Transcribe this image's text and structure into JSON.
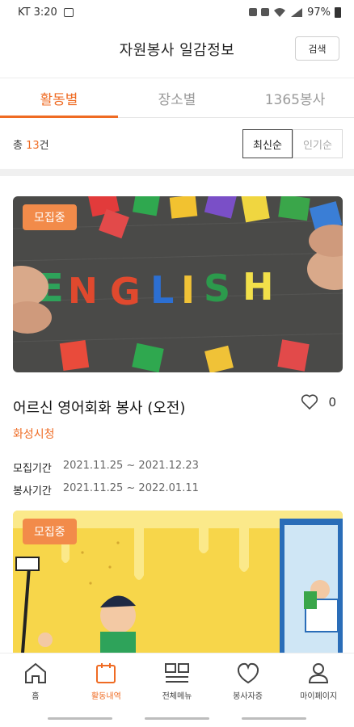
{
  "status_bar": {
    "carrier_time": "KT 3:20",
    "battery": "97%"
  },
  "header": {
    "title": "자원봉사 일감정보",
    "search_label": "검색"
  },
  "tabs": [
    {
      "label": "활동별",
      "active": true
    },
    {
      "label": "장소별",
      "active": false
    },
    {
      "label": "1365봉사",
      "active": false
    }
  ],
  "list": {
    "total_prefix": "총 ",
    "total_count": "13",
    "total_suffix": "건",
    "sort_options": [
      {
        "label": "최신순",
        "active": true
      },
      {
        "label": "인기순",
        "active": false
      }
    ]
  },
  "cards": [
    {
      "badge": "모집중",
      "image_letters": "ENGLISH",
      "title": "어르신 영어회화 봉사 (오전)",
      "org": "화성시청",
      "like_count": "0",
      "recruit_label": "모집기간",
      "recruit_period": "2021.11.25 ~ 2021.12.23",
      "service_label": "봉사기간",
      "service_period": "2021.11.25 ~ 2022.01.11"
    },
    {
      "badge": "모집중"
    }
  ],
  "bottom_nav": [
    {
      "label": "홈",
      "icon": "home-icon",
      "active": false
    },
    {
      "label": "활동내역",
      "icon": "calendar-icon",
      "active": true
    },
    {
      "label": "전체메뉴",
      "icon": "menu-grid-icon",
      "active": false
    },
    {
      "label": "봉사자증",
      "icon": "heart-icon",
      "active": false
    },
    {
      "label": "마이페이지",
      "icon": "person-icon",
      "active": false
    }
  ],
  "colors": {
    "accent": "#ef6b23",
    "badge": "#f28b4a",
    "divider": "#f0f0f0"
  }
}
